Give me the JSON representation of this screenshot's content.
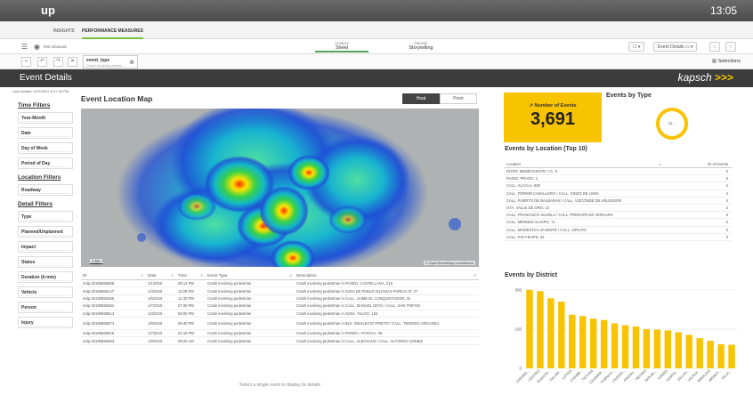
{
  "os": {
    "logo": "up",
    "clock": "13:05"
  },
  "nav": {
    "tabs": [
      "INSIGHTS",
      "PERFORMANCE MEASURES"
    ],
    "active": 1
  },
  "toolbar": {
    "app_name": "RSI-Ubisoud",
    "modes": [
      {
        "sub": "Analyze",
        "label": "Sheet"
      },
      {
        "sub": "Narrate",
        "label": "Storytelling"
      }
    ],
    "sheet_menu": "Event Details"
  },
  "selection": {
    "field": "event_type",
    "value": "Crash involving pedes...",
    "selections_label": "Selections"
  },
  "header": {
    "title": "Event Details",
    "brand": "kapsch",
    "brand_mark": ">>>"
  },
  "sidebar": {
    "last_update": "Last Update: 3/15/2022 8:17:40 PM",
    "sections": [
      {
        "title": "Time Filters",
        "filters": [
          "Year-Month",
          "Date",
          "Day of Week",
          "Period of Day"
        ]
      },
      {
        "title": "Location Filters",
        "filters": [
          "Roadway"
        ]
      },
      {
        "title": "Detail Filters",
        "filters": [
          "Type",
          "Planned/Unplanned",
          "Impact",
          "Status",
          "Duration (h:mm)",
          "Vehicle",
          "Person",
          "Injury"
        ]
      }
    ]
  },
  "map": {
    "title": "Event Location Map",
    "toggle_on": "Heat",
    "toggle_off": "Point",
    "scale": "1 km",
    "attribution": "© OpenStreetMap contributors",
    "hot_color": "#ff0000",
    "cool_color": "#1d4fd6"
  },
  "table": {
    "headers": [
      "ID",
      "Date",
      "Time",
      "Event Type",
      "Description"
    ],
    "rows": [
      [
        "mdp-20190866858",
        "1/1/2019",
        "08:14 PM",
        "Crash involving pedestrian",
        "Crash involving pedestrian in PASEO. CASTELLANA, 218"
      ],
      [
        "mdp-20190866147",
        "1/4/2019",
        "11:08 PM",
        "Crash involving pedestrian",
        "Crash involving pedestrian in AVDA DE PABLO IGLESIAS PAREJA N° 27"
      ],
      [
        "mdp-20190866355",
        "1/5/2019",
        "12:30 PM",
        "Crash involving pedestrian",
        "Crash involving pedestrian in CALL. JAIME EL CONQUISTADOR, 31"
      ],
      [
        "mdp-20190866481",
        "1/7/2019",
        "07:30 PM",
        "Crash involving pedestrian",
        "Crash involving pedestrian in CALL. MANUEL NOYA / CALL. SAN TRIFON"
      ],
      [
        "mdp-20190866613",
        "1/4/2019",
        "08:00 PM",
        "Crash involving pedestrian",
        "Crash involving pedestrian in AVDA. TALGO, 133"
      ],
      [
        "mdp-20190866574",
        "1/9/2019",
        "06:40 PM",
        "Crash involving pedestrian",
        "Crash involving pedestrian in BLV. INDALECIO PRIETO / CALL. TENDIDO ARGANDA"
      ],
      [
        "mdp-20190866616",
        "1/7/2019",
        "01:15 PM",
        "Crash involving pedestrian",
        "Crash involving pedestrian in RONDA. ATOCHA, 38"
      ],
      [
        "mdp-20190866663",
        "1/8/2019",
        "08:20 AM",
        "Crash involving pedestrian",
        "Crash involving pedestrian in CALL. ALBASANZ / CALL. ALFONSO GOMEZ"
      ]
    ],
    "footer_note": "Select a single event to display its details"
  },
  "kpi": {
    "label": "Number of Events",
    "value": "3,691",
    "color": "#f8c300"
  },
  "events_by_type": {
    "title": "Events by Type",
    "center_label": "Cr..."
  },
  "locations": {
    "title": "Events by Location (Top 10)",
    "headers": [
      "Location",
      "Nr of Events"
    ],
    "rows": [
      [
        "INTER. BENEFICENTE 7-C, 8",
        "5"
      ],
      [
        "RADIO. PRADO, 1",
        "5"
      ],
      [
        "CALL. ALCALA, 830",
        "4"
      ],
      [
        "CALL. FERMIN CABALLERO / CALL. GINZO DE LIMIA",
        "4"
      ],
      [
        "CALL. PUERTO DE BALBARAN / CALL. VIZCONDE DE ARLESSON",
        "4"
      ],
      [
        "GTA. VALLE DE ORO, 13",
        "4"
      ],
      [
        "CALL. FRANCISCO SILVELA / CALL. PRINCIPE DE VERGARA",
        "3"
      ],
      [
        "CALL. MENDEZ ALVARO, 71",
        "3"
      ],
      [
        "CALL. MODESTO LAFUENTE / CALL. VIRIATO",
        "3"
      ],
      [
        "CALL. PIO FELIPE, 34",
        "3"
      ]
    ]
  },
  "chart_data": {
    "type": "bar",
    "title": "Events by District",
    "bar_color": "#f8c300",
    "categories": [
      "CARABA...",
      "CENTRO",
      "PUENTE...",
      "SALAM...",
      "LATINA",
      "CHAMB...",
      "TETUAN",
      "CHAMAR...",
      "FUENCA...",
      "CIUDAD...",
      "ARGAN...",
      "RETIRO",
      "SAN BL...",
      "USERA",
      "HORTA...",
      "VILLAV...",
      "VICALV...",
      "BARAJAS",
      "MORAT...",
      "VILLA..."
    ],
    "values": [
      300,
      295,
      268,
      255,
      205,
      200,
      190,
      185,
      172,
      165,
      160,
      150,
      148,
      145,
      138,
      128,
      115,
      105,
      92,
      90
    ],
    "yticks": [
      0,
      150,
      300
    ],
    "ylim": [
      0,
      320
    ]
  }
}
